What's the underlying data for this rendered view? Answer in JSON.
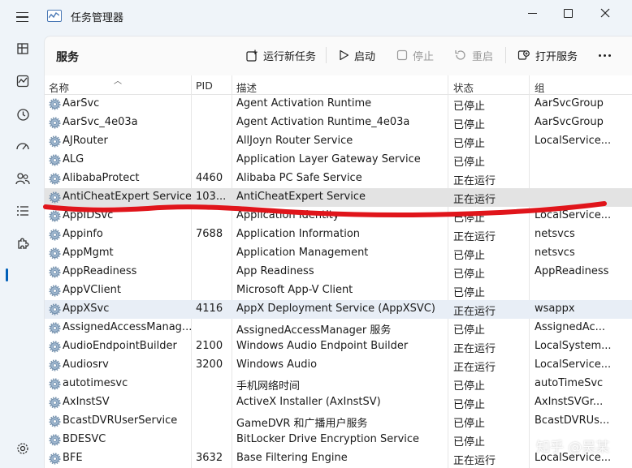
{
  "window": {
    "title": "任务管理器"
  },
  "toolbar": {
    "page_title": "服务",
    "run_new_task": "运行新任务",
    "start": "启动",
    "stop": "停止",
    "restart": "重启",
    "open_services": "打开服务"
  },
  "columns": {
    "name": "名称",
    "pid": "PID",
    "description": "描述",
    "status": "状态",
    "group": "组"
  },
  "rows": [
    {
      "name": "AarSvc",
      "pid": "",
      "desc": "Agent Activation Runtime",
      "status": "已停止",
      "group": "AarSvcGroup"
    },
    {
      "name": "AarSvc_4e03a",
      "pid": "",
      "desc": "Agent Activation Runtime_4e03a",
      "status": "已停止",
      "group": "AarSvcGroup"
    },
    {
      "name": "AJRouter",
      "pid": "",
      "desc": "AllJoyn Router Service",
      "status": "已停止",
      "group": "LocalService..."
    },
    {
      "name": "ALG",
      "pid": "",
      "desc": "Application Layer Gateway Service",
      "status": "已停止",
      "group": ""
    },
    {
      "name": "AlibabaProtect",
      "pid": "4460",
      "desc": "Alibaba PC Safe Service",
      "status": "正在运行",
      "group": ""
    },
    {
      "name": "AntiCheatExpert Service",
      "pid": "103...",
      "desc": "AntiCheatExpert Service",
      "status": "正在运行",
      "group": ""
    },
    {
      "name": "AppIDSvc",
      "pid": "",
      "desc": "Application Identity",
      "status": "已停止",
      "group": "LocalService..."
    },
    {
      "name": "Appinfo",
      "pid": "7688",
      "desc": "Application Information",
      "status": "正在运行",
      "group": "netsvcs"
    },
    {
      "name": "AppMgmt",
      "pid": "",
      "desc": "Application Management",
      "status": "已停止",
      "group": "netsvcs"
    },
    {
      "name": "AppReadiness",
      "pid": "",
      "desc": "App Readiness",
      "status": "已停止",
      "group": "AppReadiness"
    },
    {
      "name": "AppVClient",
      "pid": "",
      "desc": "Microsoft App-V Client",
      "status": "已停止",
      "group": ""
    },
    {
      "name": "AppXSvc",
      "pid": "4116",
      "desc": "AppX Deployment Service (AppXSVC)",
      "status": "正在运行",
      "group": "wsappx"
    },
    {
      "name": "AssignedAccessManag...",
      "pid": "",
      "desc": "AssignedAccessManager 服务",
      "status": "已停止",
      "group": "AssignedAc..."
    },
    {
      "name": "AudioEndpointBuilder",
      "pid": "2100",
      "desc": "Windows Audio Endpoint Builder",
      "status": "正在运行",
      "group": "LocalSystem..."
    },
    {
      "name": "Audiosrv",
      "pid": "3200",
      "desc": "Windows Audio",
      "status": "正在运行",
      "group": "LocalService..."
    },
    {
      "name": "autotimesvc",
      "pid": "",
      "desc": "手机网络时间",
      "status": "已停止",
      "group": "autoTimeSvc"
    },
    {
      "name": "AxInstSV",
      "pid": "",
      "desc": "ActiveX Installer (AxInstSV)",
      "status": "已停止",
      "group": "AxInstSVGr..."
    },
    {
      "name": "BcastDVRUserService",
      "pid": "",
      "desc": "GameDVR 和广播用户服务",
      "status": "已停止",
      "group": "BcastDVRUs..."
    },
    {
      "name": "BDESVC",
      "pid": "",
      "desc": "BitLocker Drive Encryption Service",
      "status": "已停止",
      "group": ""
    },
    {
      "name": "BFE",
      "pid": "3632",
      "desc": "Base Filtering Engine",
      "status": "正在运行",
      "group": "LocalService..."
    }
  ],
  "watermark": "知乎 @吴某",
  "colors": {
    "accent": "#005fb8",
    "annotation_red": "#e0151b"
  }
}
